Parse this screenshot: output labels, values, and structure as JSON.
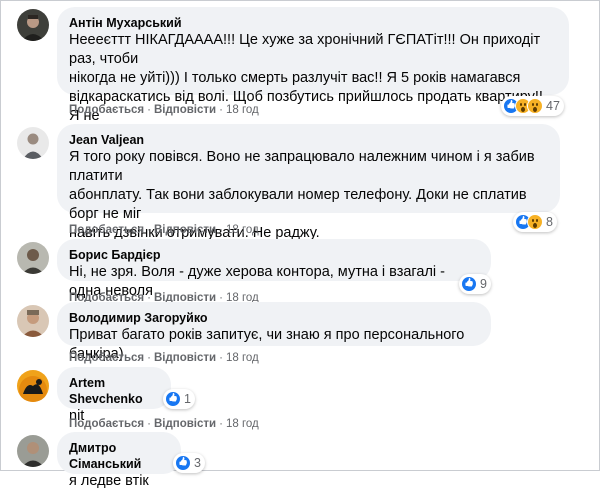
{
  "colors": {
    "bubble": "#f0f2f5",
    "secondary_text": "#65676b",
    "like_blue": "#1877f2",
    "wow_yellow": "#f7b125"
  },
  "action_labels": {
    "like": "Подобається",
    "reply": "Відповісти",
    "separator": "·"
  },
  "comments": [
    {
      "author": "Антін Мухарський",
      "text": "Неееєттт НІКАГДАААА!!! Це хуже за хронічний ГЄПАТіт!!! Он приходіт раз, чтоби\nнікогда не уйті))) І только смерть разлучіт вас!! Я 5 років намагався\nвідкараскатись від волі. Щоб позбутись прийшлось продать квартиру!! Я не\nшучу))))",
      "time": "18 год",
      "reaction_icons": [
        "like-icon",
        "wow-icon",
        "wow-icon"
      ],
      "reaction_count": "47"
    },
    {
      "author": "Jean Valjean",
      "text": "Я того року повівся. Воно не запрацювало належним чином і я забив платити\nабонплату. Так вони заблокували номер телефону. Доки не сплатив борг не міг\nнавіть дзвінки отримувати. Не раджу.\nPS Все обіцяне виявиться перебільшенням.",
      "time": "18 год",
      "reaction_icons": [
        "like-icon",
        "wow-icon"
      ],
      "reaction_count": "8"
    },
    {
      "author": "Борис Бардієр",
      "text": "Ні, не зря. Воля - дуже херова контора, мутна і взагалі - одна неволя",
      "time": "18 год",
      "reaction_icons": [
        "like-icon"
      ],
      "reaction_count": "9"
    },
    {
      "author": "Володимир Загоруйко",
      "text": "Приват багато років запитує, чи знаю я про персонального банкіра)",
      "time": "18 год",
      "reaction_icons": [],
      "reaction_count": ""
    },
    {
      "author": "Artem Shevchenko",
      "text": "nit",
      "time": "18 год",
      "reaction_icons": [
        "like-icon"
      ],
      "reaction_count": "1"
    },
    {
      "author": "Дмитро Сіманський",
      "text": "я ледве втік",
      "time": "18 год",
      "reaction_icons": [
        "like-icon"
      ],
      "reaction_count": "3"
    }
  ]
}
